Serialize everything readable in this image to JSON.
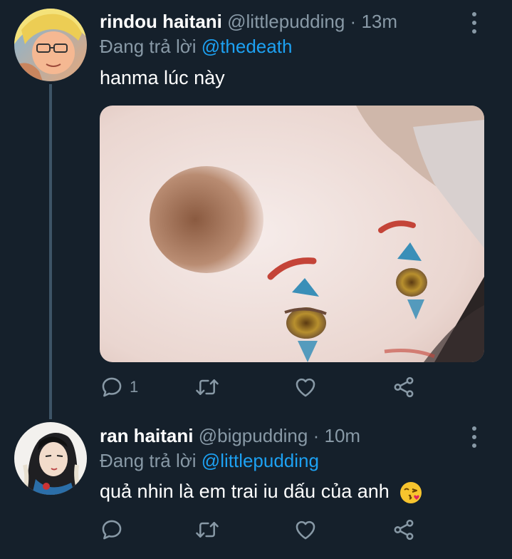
{
  "tweets": [
    {
      "name": "rindou haitani",
      "handle": "@littlepudding",
      "separator": "·",
      "time": "13m",
      "replying_prefix": "Đang trả lời",
      "replying_to": "@thedeath",
      "text": "hanma lúc này",
      "reply_count": "1"
    },
    {
      "name": "ran haitani",
      "handle": "@bigpudding",
      "separator": "·",
      "time": "10m",
      "replying_prefix": "Đang trả lời",
      "replying_to": "@littlepudding",
      "text": "quả nhin là em trai iu dấu của anh",
      "emoji": "kissing-face-emoji"
    }
  ],
  "icons": [
    "reply-icon",
    "retweet-icon",
    "like-icon",
    "share-icon",
    "more-icon"
  ],
  "colors": {
    "background": "#15202b",
    "secondary_text": "#8899a6",
    "accent": "#1da1f2",
    "thread_line": "#3d5466"
  }
}
